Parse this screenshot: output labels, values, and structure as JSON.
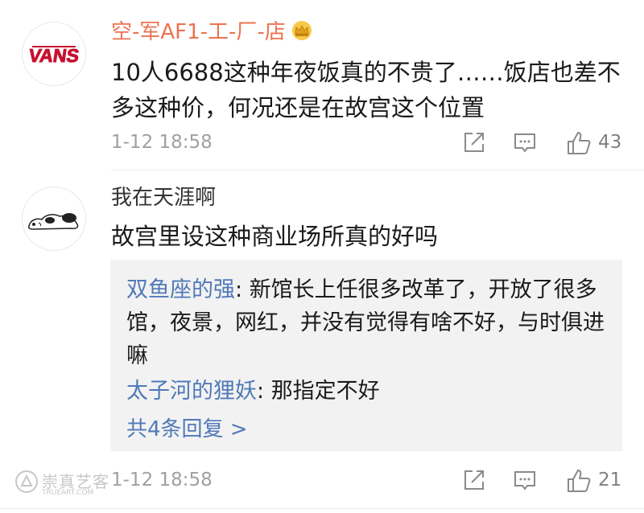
{
  "comments": [
    {
      "username": "空-军AF1-工-厂-店",
      "avatar_text": "VANS",
      "text": "10人6688这种年夜饭真的不贵了……饭店也差不多这种价，何况还是在故宫这个位置",
      "time": "1-12 18:58",
      "likes": "43"
    },
    {
      "username": "我在天涯啊",
      "text": "故宫里设这种商业场所真的好吗",
      "time": "1-12 18:58",
      "likes": "21",
      "replies": [
        {
          "user": "双鱼座的强",
          "sep": ": ",
          "text": "新馆长上任很多改革了，开放了很多馆，夜景，网红，并没有觉得有啥不好，与时俱进嘛"
        },
        {
          "user": "太子河的狸妖",
          "sep": ": ",
          "text": "那指定不好"
        }
      ],
      "more_replies": "共4条回复 >"
    }
  ],
  "watermark": {
    "text": "崇真艺客",
    "sub": "TRUEART.COM"
  },
  "colors": {
    "vip_username": "#eb7350",
    "reply_user": "#5079b8",
    "reply_bg": "#f2f2f2",
    "meta": "#a0a0a0"
  },
  "icons": {
    "forward": "forward-icon",
    "comment": "comment-icon",
    "like": "like-icon",
    "crown": "crown-badge-icon"
  }
}
